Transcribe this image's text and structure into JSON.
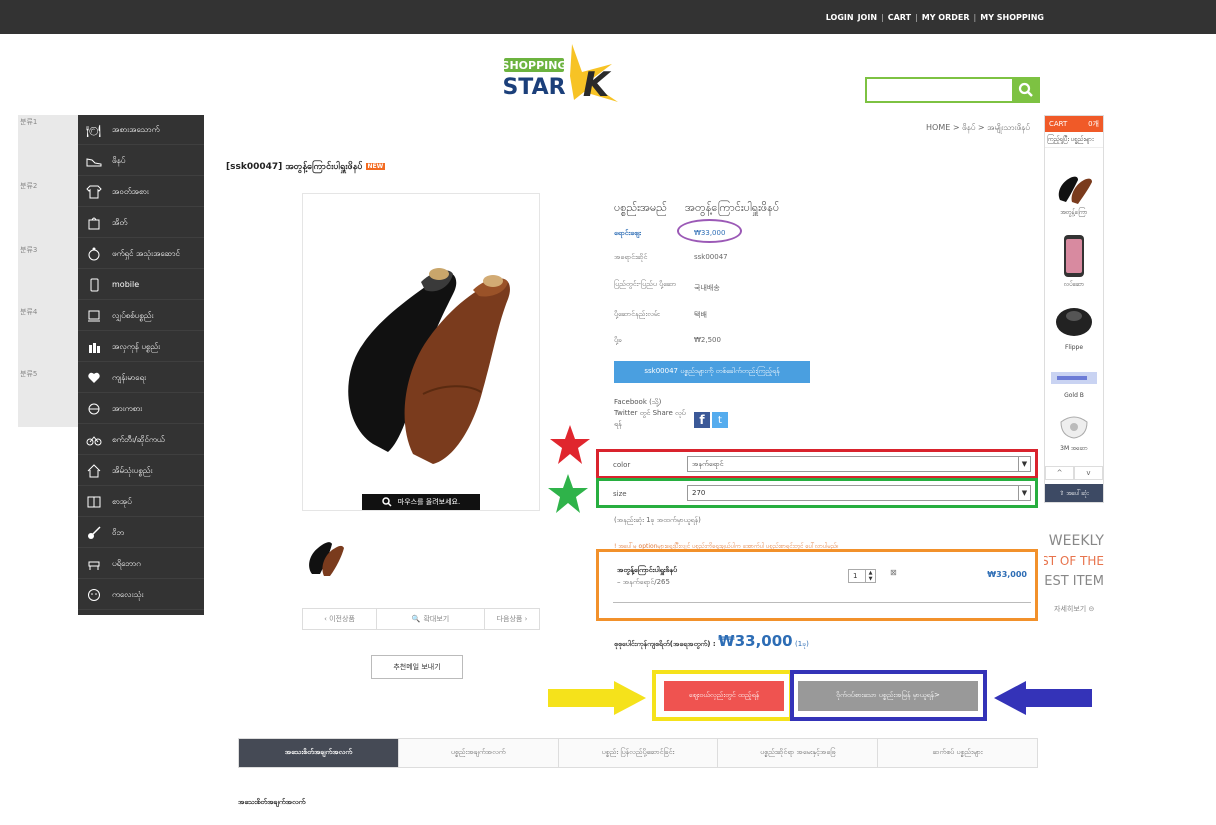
{
  "topnav": {
    "login": "LOGIN",
    "join": "JOIN",
    "cart": "CART",
    "my_order": "MY ORDER",
    "my_shopping": "MY SHOPPING"
  },
  "logo": {
    "line1": "SHOPPING",
    "line2": "STAR",
    "mark": "K"
  },
  "search": {
    "placeholder": "",
    "icon": "search-icon"
  },
  "side_labels": [
    "분류1",
    "분류2",
    "분류3",
    "분류4",
    "분류5"
  ],
  "menu": [
    {
      "label": "အစားအသောက်",
      "icon": "dining-icon"
    },
    {
      "label": "ဖိနပ်",
      "icon": "shoe-icon"
    },
    {
      "label": "အဝတ်အစား",
      "icon": "shirt-icon"
    },
    {
      "label": "အိတ်",
      "icon": "bag-icon"
    },
    {
      "label": "ဖက်ရှင် အသုံးအဆောင်",
      "icon": "accessory-icon"
    },
    {
      "label": "mobile",
      "icon": "mobile-icon"
    },
    {
      "label": "လျှပ်စစ်ပစ္စည်း",
      "icon": "appliance-icon"
    },
    {
      "label": "အလှကုန် ပစ္စည်း",
      "icon": "cosmetics-icon"
    },
    {
      "label": "ကျန်းမာရေး",
      "icon": "health-icon"
    },
    {
      "label": "အားကစား",
      "icon": "sports-icon"
    },
    {
      "label": "စက်ဘီး/ဆိုင်ကယ်",
      "icon": "bicycle-icon"
    },
    {
      "label": "အိမ်သုံးပစ္စည်း",
      "icon": "home-icon"
    },
    {
      "label": "စာအုပ်",
      "icon": "book-icon"
    },
    {
      "label": "ဝိဘ",
      "icon": "guitar-icon"
    },
    {
      "label": "ပရိဘောဂ",
      "icon": "furniture-icon"
    },
    {
      "label": "ကလေးသုံး",
      "icon": "baby-icon"
    }
  ],
  "breadcrumb": "HOME > ဖိနပ် > အမျိုးသားဖိနပ်",
  "product": {
    "title": "[ssk00047] အတွန့်ကြောင်းပါရှူးဖိနပ်",
    "badge": "NEW",
    "name_label": "ပစ္စည်းအမည်",
    "name_value": "အတွန့်ကြောင်းပါရှူးဖိနပ်",
    "price_label": "ရောင်းဈေး",
    "price_value": "₩33,000",
    "code_label": "အရောင်းဆိုင်",
    "code_value": "ssk00047",
    "origin_label": "ပြည်တွင်း-ပြည်ပ ပို့ဆော",
    "origin_value": "국내배송",
    "ship_label": "ပို့ဆောင်နည်းလမ်း",
    "ship_value": "택배",
    "fee_label": "ပို့ခ",
    "fee_value": "₩2,500",
    "ask_button": "ssk00047 ပစ္စည်းများကို တစ်ခေါက်တည်းကြည့်ရန်",
    "share_text": "Facebook (သို့) Twitter တွင် Share လုပ်ရန်",
    "zoom_hint": "마우스를 올려보세요.",
    "prev": "‹ 이전상품",
    "zoom": "확대보기",
    "next": "다음상품 ›",
    "send_button": "추천메일 보내기"
  },
  "options": {
    "color_label": "color",
    "color_value": "အနက်ရောင်",
    "size_label": "size",
    "size_value": "270",
    "min_qty": "(အနည်းဆုံး 1ခု အထက်မှာယူရန်)",
    "notice": "! အပေါ်မှ optionများရွေးပြီးလျှင် ပစ္စည်းကိုရွေးချယ်ပါက အောက်ပါ ပစ္စည်းစာရင်းတွင် ပေါ်လာပါမည်။"
  },
  "selected_item": {
    "name": "အတွန့်ကြောင်းပါရှူးဖိနပ်",
    "variant": "– အနက်ရောင်/265",
    "qty": "1",
    "price": "₩33,000"
  },
  "total": {
    "label": "စုစုပေါင်းကုန်ကျစရိတ်(အရေအတွက်) :",
    "amount": "₩33,000",
    "count": "(1ခု)"
  },
  "buttons": {
    "cart": "ဈေးဝယ်လှည်းတွင် ထည့်ရန်",
    "buy": "ဝိုက်ဝပ်စားသော ပစ္စည်းအမြန် မှာယူရန်>"
  },
  "tabs": [
    "အသေးစိတ်အချက်အလက်",
    "ပစ္စည်းအချက်အလက်",
    "ပစ္စည်း ပြန်လည်ပို့ဆောင်ခြင်း",
    "ပစ္စည်းဆိုင်ရာ အမေးနှင့်အဖြေ",
    "ဆက်စပ် ပစ္စည်းများ"
  ],
  "bottom_title": "အသေးစိတ်အချက်အလက်",
  "cart_widget": {
    "title": "CART",
    "count": "0개",
    "subtitle": "ကြည့်ရှုပြီး ပစ္စည်းများ",
    "items": [
      "အတွန့်ကြော",
      "လပ်ဆော",
      "Flippe",
      "Gold B",
      "3M အဆော"
    ],
    "up": "^",
    "down": "v",
    "footer": "⇧ အပေါ်ဆုံး"
  },
  "weekly": {
    "line1": "WEEKLY",
    "line2": "BEST OF THE",
    "line3": "BEST ITEM",
    "more": "자세히보기"
  },
  "colors": {
    "accent_green": "#7dc242",
    "price_blue": "#2d6db5",
    "cart_red": "#ef5350",
    "annotation_red": "#d9232d",
    "annotation_green": "#27ae3f",
    "annotation_orange": "#f2912b",
    "annotation_yellow": "#f5e21b",
    "annotation_blue": "#3433b8",
    "annotation_purple": "#9b59b6"
  }
}
